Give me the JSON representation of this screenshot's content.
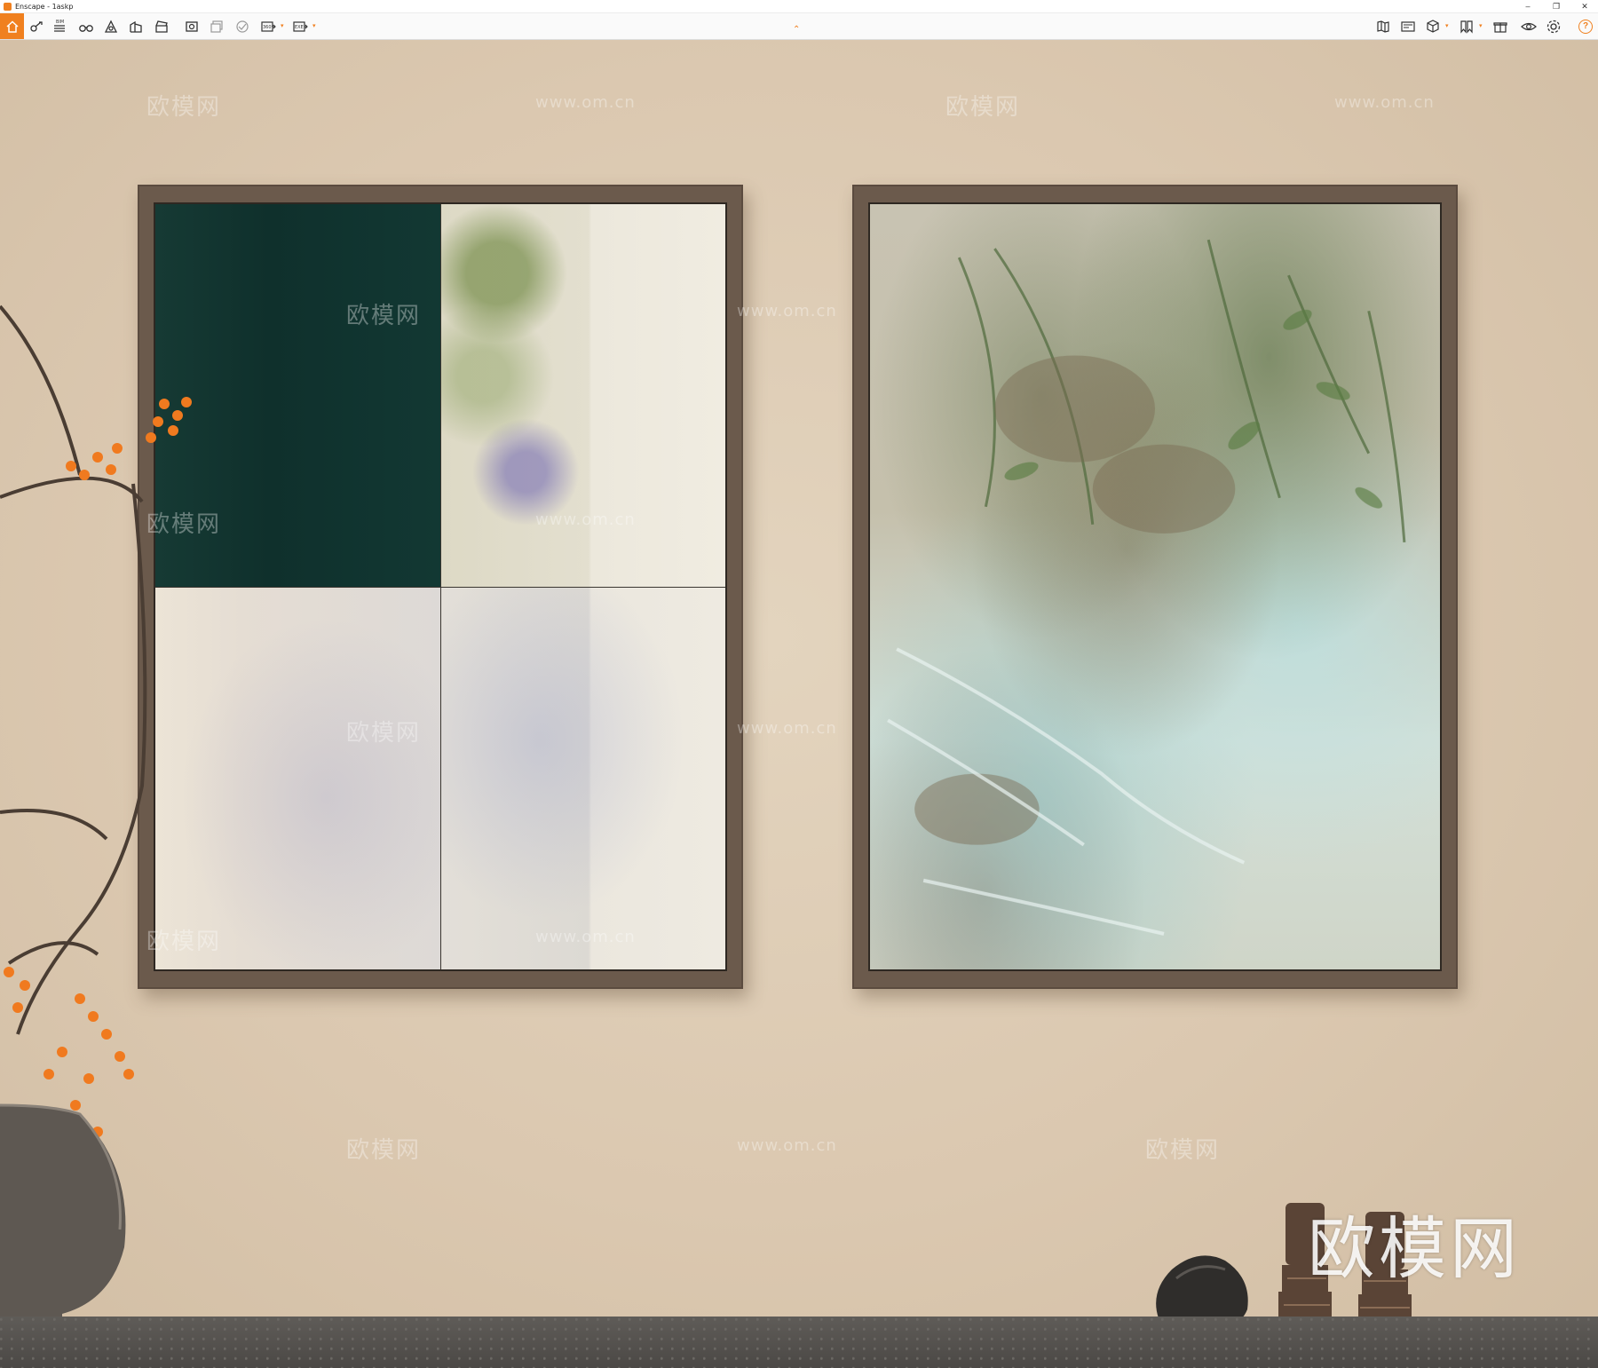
{
  "window": {
    "title": "Enscape - 1askp",
    "controls": [
      "–",
      "❐",
      "✕"
    ]
  },
  "toolbar": {
    "tools": [
      {
        "name": "home",
        "icon": "home-icon"
      },
      {
        "name": "views",
        "icon": "views-icon"
      },
      {
        "name": "bim",
        "icon": "bim-icon",
        "label": "BIM"
      },
      {
        "name": "visual-settings",
        "icon": "binoculars-icon"
      },
      {
        "name": "asset-library",
        "icon": "asset-icon"
      },
      {
        "name": "material-editor",
        "icon": "building-icon"
      },
      {
        "name": "sync",
        "icon": "clapper-icon"
      },
      {
        "name": "screenshot",
        "icon": "screenshot-icon"
      },
      {
        "name": "batch-render",
        "icon": "batch-icon"
      },
      {
        "name": "panorama",
        "icon": "panorama-icon"
      },
      {
        "name": "export-360",
        "icon": "export-360-icon",
        "label": "360°"
      },
      {
        "name": "export-exe",
        "icon": "export-exe-icon",
        "label": "EXE"
      }
    ],
    "right_tools": [
      "map-icon",
      "video-editor-icon",
      "cube-icon",
      "bookmark-icon",
      "gift-icon",
      "eye-icon",
      "settings-icon"
    ],
    "help": "?"
  },
  "scene": {
    "watermark_cn": "欧模网",
    "watermark_url": "www.om.cn",
    "logo": "欧模网"
  },
  "colors": {
    "accent": "#f0801f",
    "wall": "#dbc8b0",
    "frame": "#6b5a4c"
  }
}
